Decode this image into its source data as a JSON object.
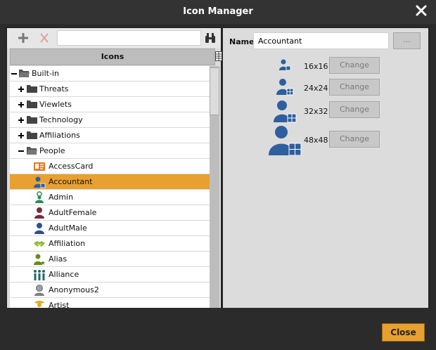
{
  "window": {
    "title": "Icon Manager"
  },
  "toolbar": {
    "add_icon": "plus-icon",
    "remove_icon": "x-icon",
    "search_placeholder": "",
    "search_value": ""
  },
  "tree": {
    "header": "Icons",
    "rows": [
      {
        "label": "Built-in",
        "toggle": "−"
      },
      {
        "label": "Threats",
        "toggle": "+"
      },
      {
        "label": "Viewlets",
        "toggle": "+"
      },
      {
        "label": "Technology",
        "toggle": "+"
      },
      {
        "label": "Affiliations",
        "toggle": "+"
      },
      {
        "label": "People",
        "toggle": "−"
      },
      {
        "label": "AccessCard"
      },
      {
        "label": "Accountant"
      },
      {
        "label": "Admin"
      },
      {
        "label": "AdultFemale"
      },
      {
        "label": "AdultMale"
      },
      {
        "label": "Affiliation"
      },
      {
        "label": "Alias"
      },
      {
        "label": "Alliance"
      },
      {
        "label": "Anonymous2"
      },
      {
        "label": "Artist"
      }
    ],
    "selected": "Accountant"
  },
  "details": {
    "name_label": "Name",
    "name_value": "Accountant",
    "browse_label": "...",
    "sizes": [
      {
        "label": "16x16",
        "button": "Change"
      },
      {
        "label": "24x24",
        "button": "Change"
      },
      {
        "label": "32x32",
        "button": "Change"
      },
      {
        "label": "48x48",
        "button": "Change"
      }
    ]
  },
  "footer": {
    "close_label": "Close"
  },
  "colors": {
    "accent": "#e8a030",
    "icon_blue": "#2e5f9e",
    "panel": "#dcdcdc"
  }
}
